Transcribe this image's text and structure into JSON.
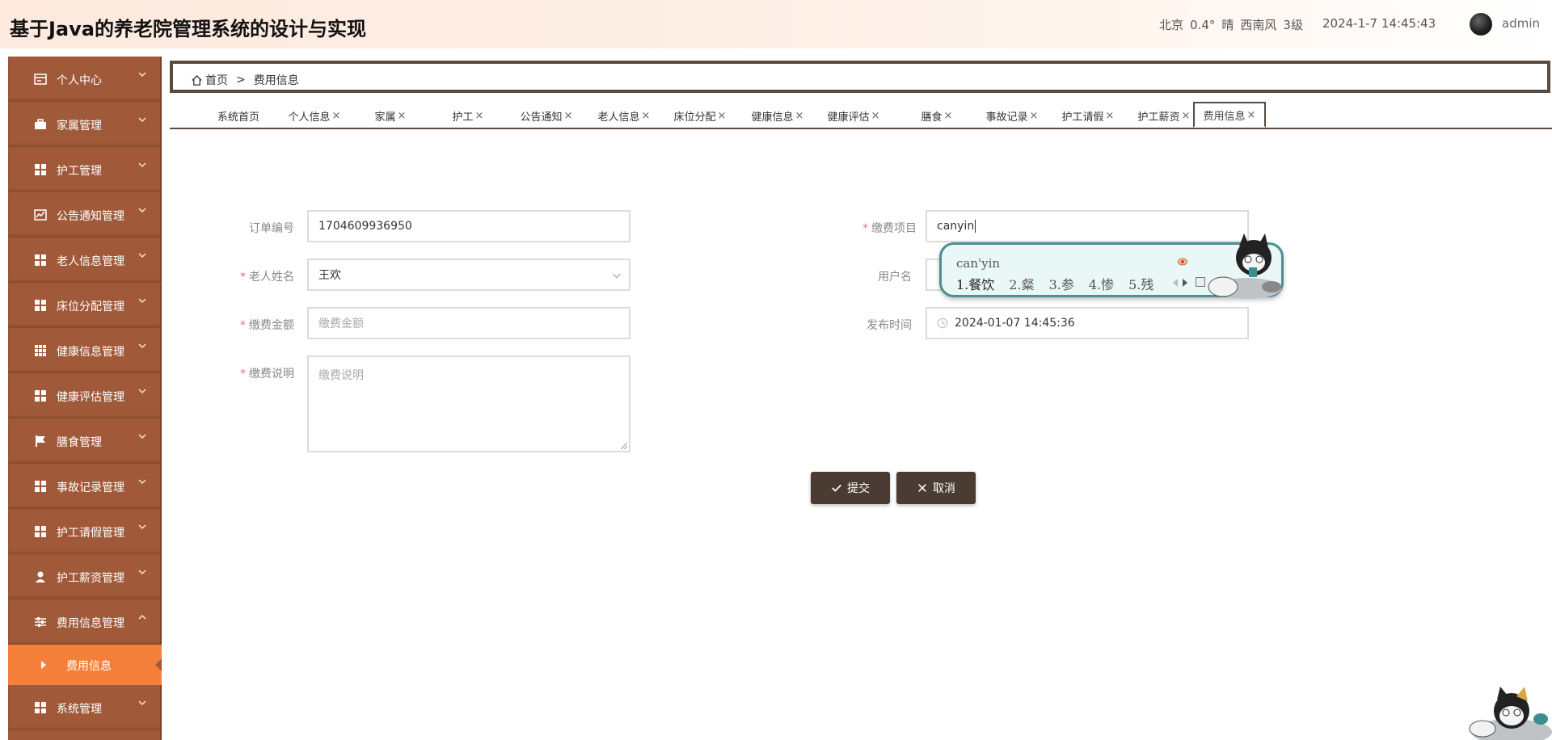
{
  "header": {
    "title": "基于Java的养老院管理系统的设计与实现",
    "weather": {
      "city": "北京",
      "temp": "0.4°",
      "condition": "晴",
      "wind": "西南风",
      "level": "3级"
    },
    "datetime": "2024-1-7 14:45:43",
    "username": "admin"
  },
  "sidebar": {
    "items": [
      {
        "label": "个人中心",
        "icon": "id-card-icon"
      },
      {
        "label": "家属管理",
        "icon": "briefcase-icon"
      },
      {
        "label": "护工管理",
        "icon": "grid-icon"
      },
      {
        "label": "公告通知管理",
        "icon": "chart-icon"
      },
      {
        "label": "老人信息管理",
        "icon": "grid-icon"
      },
      {
        "label": "床位分配管理",
        "icon": "grid-icon"
      },
      {
        "label": "健康信息管理",
        "icon": "table-icon"
      },
      {
        "label": "健康评估管理",
        "icon": "grid-icon"
      },
      {
        "label": "膳食管理",
        "icon": "flag-icon"
      },
      {
        "label": "事故记录管理",
        "icon": "grid-icon"
      },
      {
        "label": "护工请假管理",
        "icon": "grid-icon"
      },
      {
        "label": "护工薪资管理",
        "icon": "user-icon"
      },
      {
        "label": "费用信息管理",
        "icon": "sliders-icon"
      }
    ],
    "subitem": "费用信息",
    "last_item": {
      "label": "系统管理",
      "icon": "grid-icon"
    }
  },
  "breadcrumb": {
    "home": "首页",
    "separator": ">",
    "current": "费用信息"
  },
  "tabs": [
    {
      "label": "系统首页",
      "closable": false
    },
    {
      "label": "个人信息",
      "closable": true
    },
    {
      "label": "家属",
      "closable": true
    },
    {
      "label": "护工",
      "closable": true
    },
    {
      "label": "公告通知",
      "closable": true
    },
    {
      "label": "老人信息",
      "closable": true
    },
    {
      "label": "床位分配",
      "closable": true
    },
    {
      "label": "健康信息",
      "closable": true
    },
    {
      "label": "健康评估",
      "closable": true
    },
    {
      "label": "膳食",
      "closable": true
    },
    {
      "label": "事故记录",
      "closable": true
    },
    {
      "label": "护工请假",
      "closable": true
    },
    {
      "label": "护工薪资",
      "closable": true
    },
    {
      "label": "费用信息",
      "closable": true
    }
  ],
  "tab_close": "×",
  "form": {
    "order_no": {
      "label": "订单编号",
      "value": "1704609936950"
    },
    "item": {
      "label": "缴费项目",
      "value": "canyin"
    },
    "elder_name": {
      "label": "老人姓名",
      "value": "王欢"
    },
    "username": {
      "label": "用户名"
    },
    "amount": {
      "label": "缴费金额",
      "placeholder": "缴费金额"
    },
    "publish_time": {
      "label": "发布时间",
      "value": "2024-01-07 14:45:36"
    },
    "description": {
      "label": "缴费说明",
      "placeholder": "缴费说明"
    }
  },
  "buttons": {
    "submit": "提交",
    "cancel": "取消"
  },
  "ime": {
    "pinyin": "can'yin",
    "candidates": [
      "1.餐饮",
      "2.粲",
      "3.参",
      "4.惨",
      "5.残"
    ]
  },
  "colors": {
    "sidebar": "#a05a3a",
    "active": "#f5803b",
    "dark": "#4a3c32"
  }
}
